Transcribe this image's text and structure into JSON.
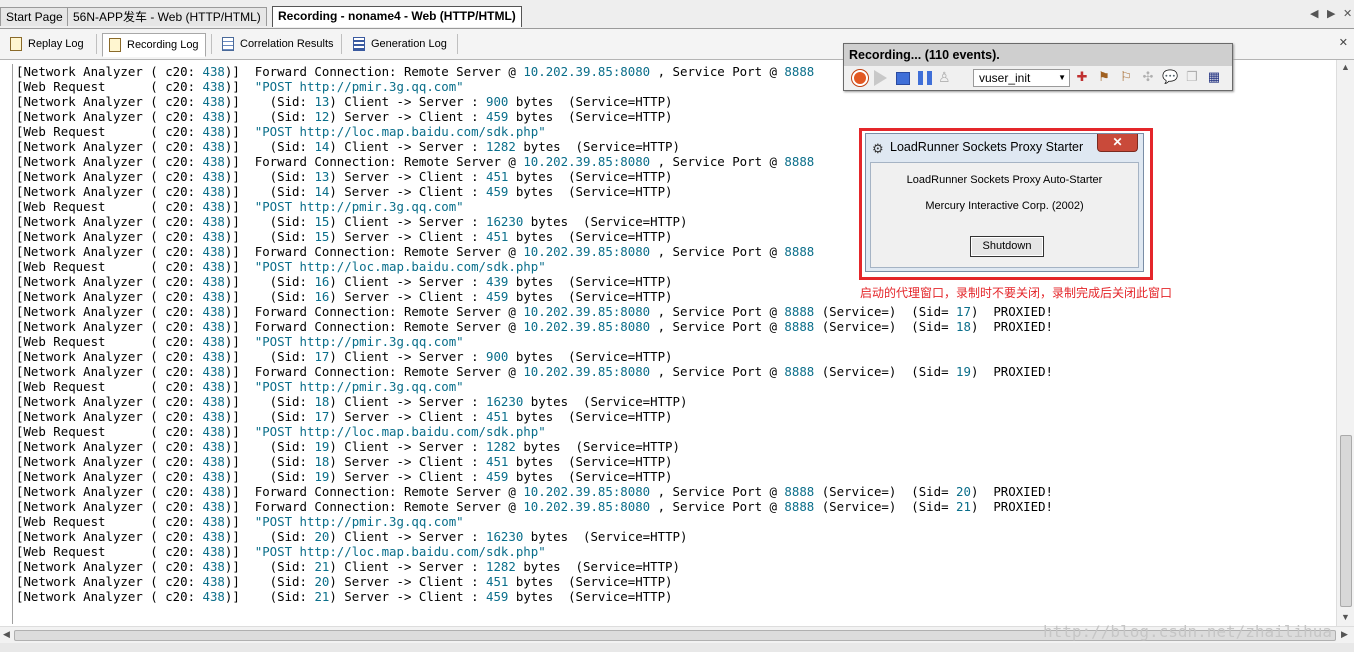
{
  "doc_tabs": [
    "Start Page",
    "56N-APP发车 - Web (HTTP/HTML)",
    "Recording - noname4 - Web (HTTP/HTML)"
  ],
  "output_tabs": [
    "Replay Log",
    "Recording Log",
    "Correlation Results",
    "Generation Log"
  ],
  "recording_toolbar": {
    "title": "Recording... (110 events).",
    "action": "vuser_init"
  },
  "proxy_dialog": {
    "title": "LoadRunner Sockets Proxy Starter",
    "line1": "LoadRunner Sockets Proxy Auto-Starter",
    "line2": "Mercury Interactive Corp. (2002)",
    "button": "Shutdown"
  },
  "annotation": "启动的代理窗口，录制时不要关闭，录制完成后关闭此窗口",
  "watermark": "http://blog.csdn.net/zhailihua",
  "log": {
    "source_na": "[Network Analyzer",
    "source_wr": "[Web Request",
    "conn": "c20",
    "pid": "438",
    "lines": [
      {
        "type": "fwd",
        "ip": "10.202.39.85",
        "port": "8080",
        "service_port": "8888"
      },
      {
        "type": "post",
        "url": "pmir.3g.qq.com"
      },
      {
        "type": "xfer",
        "sid": "13",
        "dir": "Client -> Server",
        "bytes": "900"
      },
      {
        "type": "xfer",
        "sid": "12",
        "dir": "Server -> Client",
        "bytes": "459"
      },
      {
        "type": "post",
        "url": "loc.map.baidu.com/sdk.php"
      },
      {
        "type": "xfer",
        "sid": "14",
        "dir": "Client -> Server",
        "bytes": "1282"
      },
      {
        "type": "fwd",
        "ip": "10.202.39.85",
        "port": "8080",
        "service_port": "8888"
      },
      {
        "type": "xfer",
        "sid": "13",
        "dir": "Server -> Client",
        "bytes": "451"
      },
      {
        "type": "xfer",
        "sid": "14",
        "dir": "Server -> Client",
        "bytes": "459"
      },
      {
        "type": "post",
        "url": "pmir.3g.qq.com"
      },
      {
        "type": "xfer",
        "sid": "15",
        "dir": "Client -> Server",
        "bytes": "16230"
      },
      {
        "type": "xfer",
        "sid": "15",
        "dir": "Server -> Client",
        "bytes": "451"
      },
      {
        "type": "fwd",
        "ip": "10.202.39.85",
        "port": "8080",
        "service_port": "8888"
      },
      {
        "type": "post",
        "url": "loc.map.baidu.com/sdk.php"
      },
      {
        "type": "xfer",
        "sid": "16",
        "dir": "Client -> Server",
        "bytes": "439"
      },
      {
        "type": "xfer",
        "sid": "16",
        "dir": "Server -> Client",
        "bytes": "459"
      },
      {
        "type": "proxied",
        "ip": "10.202.39.85",
        "port": "8080",
        "service_port": "8888",
        "sid": "17"
      },
      {
        "type": "proxied",
        "ip": "10.202.39.85",
        "port": "8080",
        "service_port": "8888",
        "sid": "18"
      },
      {
        "type": "post",
        "url": "pmir.3g.qq.com"
      },
      {
        "type": "xfer",
        "sid": "17",
        "dir": "Client -> Server",
        "bytes": "900"
      },
      {
        "type": "proxied",
        "ip": "10.202.39.85",
        "port": "8080",
        "service_port": "8888",
        "sid": "19"
      },
      {
        "type": "post",
        "url": "pmir.3g.qq.com"
      },
      {
        "type": "xfer",
        "sid": "18",
        "dir": "Client -> Server",
        "bytes": "16230"
      },
      {
        "type": "xfer",
        "sid": "17",
        "dir": "Server -> Client",
        "bytes": "451"
      },
      {
        "type": "post",
        "url": "loc.map.baidu.com/sdk.php"
      },
      {
        "type": "xfer",
        "sid": "19",
        "dir": "Client -> Server",
        "bytes": "1282"
      },
      {
        "type": "xfer",
        "sid": "18",
        "dir": "Server -> Client",
        "bytes": "451"
      },
      {
        "type": "xfer",
        "sid": "19",
        "dir": "Server -> Client",
        "bytes": "459"
      },
      {
        "type": "proxied",
        "ip": "10.202.39.85",
        "port": "8080",
        "service_port": "8888",
        "sid": "20"
      },
      {
        "type": "proxied",
        "ip": "10.202.39.85",
        "port": "8080",
        "service_port": "8888",
        "sid": "21"
      },
      {
        "type": "post",
        "url": "pmir.3g.qq.com"
      },
      {
        "type": "xfer",
        "sid": "20",
        "dir": "Client -> Server",
        "bytes": "16230"
      },
      {
        "type": "post",
        "url": "loc.map.baidu.com/sdk.php"
      },
      {
        "type": "xfer",
        "sid": "21",
        "dir": "Client -> Server",
        "bytes": "1282"
      },
      {
        "type": "xfer",
        "sid": "20",
        "dir": "Server -> Client",
        "bytes": "451"
      },
      {
        "type": "xfer",
        "sid": "21",
        "dir": "Server -> Client",
        "bytes": "459"
      }
    ]
  }
}
